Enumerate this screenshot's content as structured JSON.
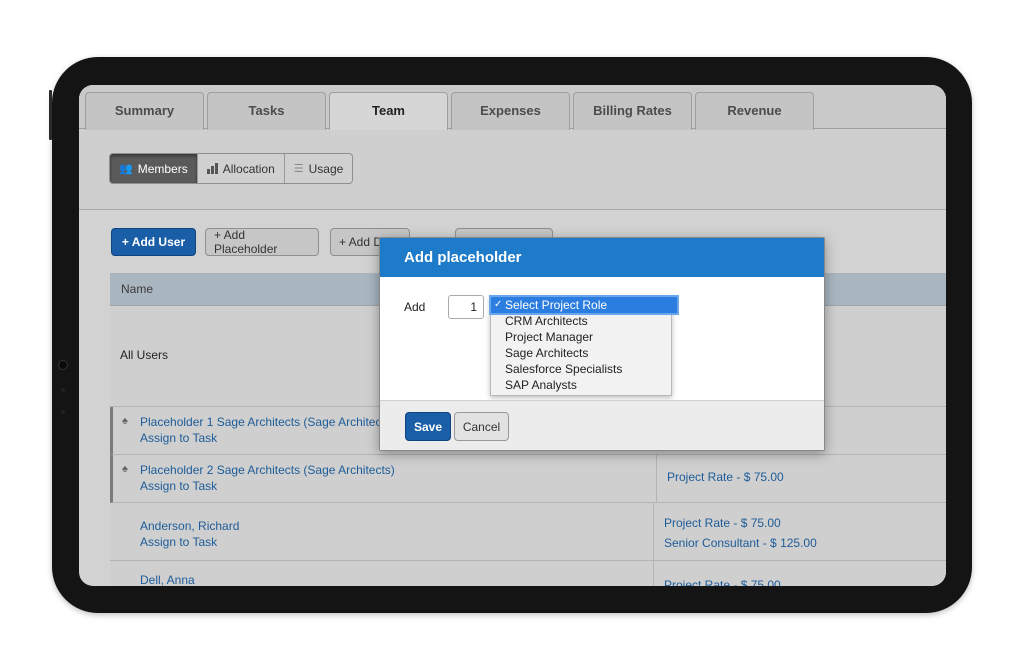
{
  "tabs": [
    {
      "label": "Summary",
      "active": false
    },
    {
      "label": "Tasks",
      "active": false
    },
    {
      "label": "Team",
      "active": true
    },
    {
      "label": "Expenses",
      "active": false
    },
    {
      "label": "Billing Rates",
      "active": false
    },
    {
      "label": "Revenue",
      "active": false
    }
  ],
  "view_switch": {
    "members": "Members",
    "allocation": "Allocation",
    "usage": "Usage"
  },
  "actions": {
    "add_user": "+ Add User",
    "add_placeholder": "+ Add Placeholder",
    "add_third": "+ Add D"
  },
  "table": {
    "header_name": "Name",
    "all_users": "All Users",
    "rows": [
      {
        "name": "Placeholder 1 Sage Architects (Sage Architec",
        "sub": "Assign to Task",
        "rates": []
      },
      {
        "name": "Placeholder 2 Sage Architects (Sage Architects)",
        "sub": "Assign to Task",
        "rates": [
          "Project Rate - $ 75.00"
        ]
      },
      {
        "name": "Anderson, Richard",
        "sub": "Assign to Task",
        "rates": [
          "Project Rate - $ 75.00",
          "Senior Consultant - $ 125.00"
        ]
      },
      {
        "name": "Dell, Anna",
        "sub": "",
        "rates": [
          "Project Rate - $ 75.00"
        ]
      }
    ]
  },
  "modal": {
    "title": "Add placeholder",
    "add_label": "Add",
    "quantity": "1",
    "role_select": {
      "selected": "Select Project Role",
      "options": [
        "CRM Architects",
        "Project Manager",
        "Sage Architects",
        "Salesforce Specialists",
        "SAP Analysts"
      ]
    },
    "save": "Save",
    "cancel": "Cancel"
  },
  "colors": {
    "primary": "#1a5ea8",
    "modal_header": "#1e7bc9",
    "link": "#1d5c99",
    "selected_option": "#2c7de0"
  }
}
